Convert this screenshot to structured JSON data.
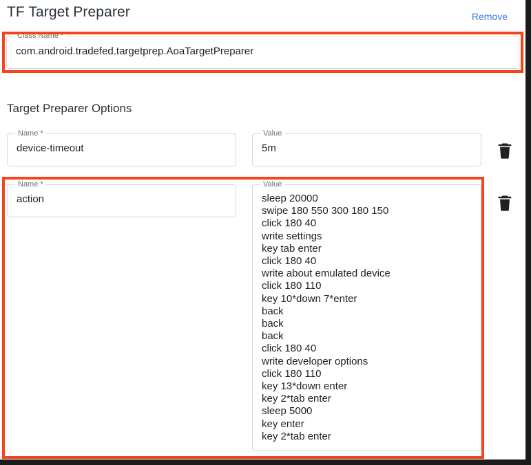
{
  "header": {
    "title": "TF Target Preparer",
    "remove_label": "Remove"
  },
  "class_field": {
    "label": "Class Name *",
    "value": "com.android.tradefed.targetprep.AoaTargetPreparer"
  },
  "options_section": {
    "title": "Target Preparer Options",
    "rows": [
      {
        "name_label": "Name *",
        "name_value": "device-timeout",
        "value_label": "Value",
        "value_value": "5m",
        "delete_icon": "trash-icon"
      },
      {
        "name_label": "Name *",
        "name_value": "action",
        "value_label": "Value",
        "value_value": "sleep 20000\nswipe 180 550 300 180 150\nclick 180 40\nwrite settings\nkey tab enter\nclick 180 40\nwrite about emulated device\nclick 180 110\nkey 10*down 7*enter\nback\nback\nback\nclick 180 40\nwrite developer options\nclick 180 110\nkey 13*down enter\nkey 2*tab enter\nsleep 5000\nkey enter\nkey 2*tab enter",
        "delete_icon": "trash-icon"
      }
    ]
  },
  "highlights": {
    "color": "#f4441e",
    "regions": [
      "class-name-field",
      "second-option-row"
    ]
  },
  "colors": {
    "accent_link": "#3b78e7",
    "highlight": "#f4441e",
    "text": "#202124",
    "field_border": "#d5d7da",
    "label": "#6d6f73"
  }
}
